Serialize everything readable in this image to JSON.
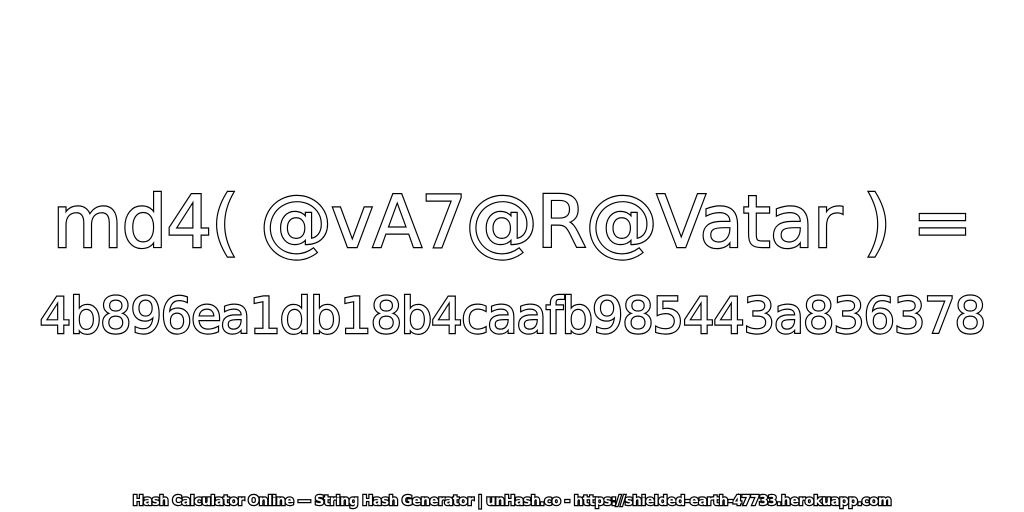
{
  "expression": "md4( @vA7@R@Vatar ) =",
  "hash_value": "4b896ea1db18b4caafb985443a836378",
  "footer": "Hash Calculator Online — String Hash Generator | unHash.co - https://shielded-earth-47733.herokuapp.com",
  "colors": {
    "background": "#ffffff",
    "text_fill": "#ffffff",
    "text_outline": "#000000"
  }
}
